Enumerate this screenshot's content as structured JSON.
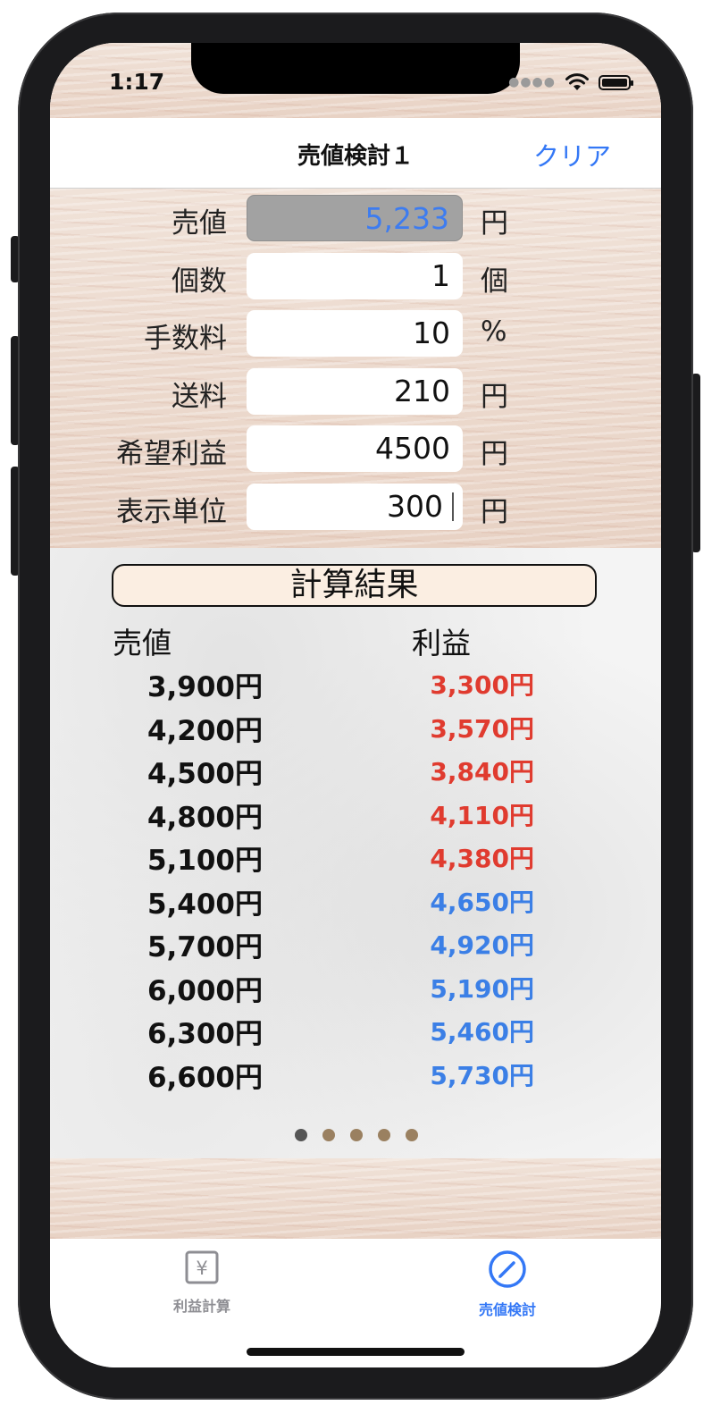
{
  "status_bar": {
    "time": "1:17"
  },
  "navbar": {
    "title": "売値検討１",
    "clear_button": "クリア"
  },
  "form": {
    "rows": [
      {
        "label": "売値",
        "value": "5,233",
        "unit": "円",
        "readonly": true
      },
      {
        "label": "個数",
        "value": "1",
        "unit": "個",
        "readonly": false
      },
      {
        "label": "手数料",
        "value": "10",
        "unit": "%",
        "readonly": false
      },
      {
        "label": "送料",
        "value": "210",
        "unit": "円",
        "readonly": false
      },
      {
        "label": "希望利益",
        "value": "4500",
        "unit": "円",
        "readonly": false
      },
      {
        "label": "表示単位",
        "value": "300",
        "unit": "円",
        "readonly": false
      }
    ]
  },
  "results": {
    "header": "計算結果",
    "sale_column": "売値",
    "profit_column": "利益",
    "rows": [
      {
        "sale": "3,900円",
        "profit": "3,300円",
        "profit_color": "#e03b2f"
      },
      {
        "sale": "4,200円",
        "profit": "3,570円",
        "profit_color": "#e03b2f"
      },
      {
        "sale": "4,500円",
        "profit": "3,840円",
        "profit_color": "#e03b2f"
      },
      {
        "sale": "4,800円",
        "profit": "4,110円",
        "profit_color": "#e03b2f"
      },
      {
        "sale": "5,100円",
        "profit": "4,380円",
        "profit_color": "#e03b2f"
      },
      {
        "sale": "5,400円",
        "profit": "4,650円",
        "profit_color": "#3b7fe6"
      },
      {
        "sale": "5,700円",
        "profit": "4,920円",
        "profit_color": "#3b7fe6"
      },
      {
        "sale": "6,000円",
        "profit": "5,190円",
        "profit_color": "#3b7fe6"
      },
      {
        "sale": "6,300円",
        "profit": "5,460円",
        "profit_color": "#3b7fe6"
      },
      {
        "sale": "6,600円",
        "profit": "5,730円",
        "profit_color": "#3b7fe6"
      }
    ]
  },
  "pager": {
    "count": 5,
    "active_index": 0
  },
  "tabbar": {
    "tabs": [
      {
        "label": "利益計算",
        "icon": "yen-icon",
        "active": false
      },
      {
        "label": "売値検討",
        "icon": "pencil-circle-icon",
        "active": true
      }
    ]
  },
  "colors": {
    "accent": "#3478f6",
    "inactive_tab": "#8e8e93",
    "loss": "#e03b2f",
    "gain": "#3b7fe6"
  }
}
